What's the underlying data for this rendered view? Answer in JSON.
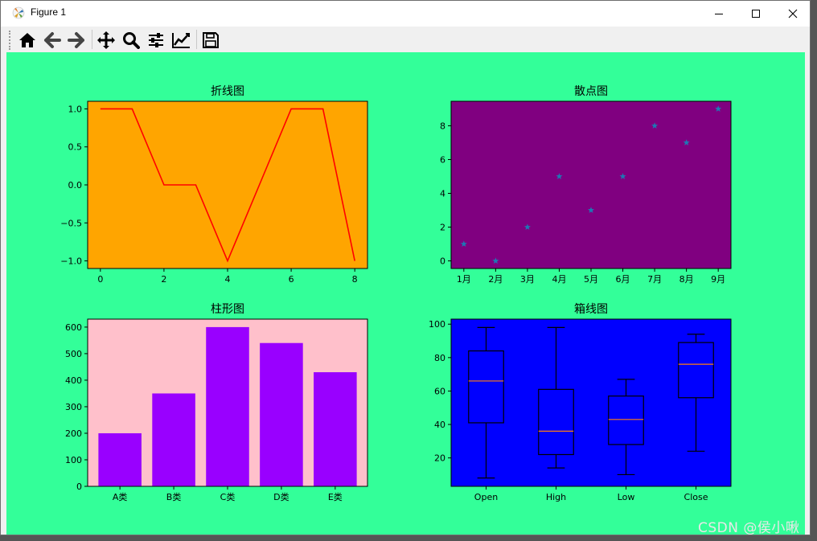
{
  "window": {
    "title": "Figure 1"
  },
  "toolbar": {
    "buttons": [
      "home-icon",
      "back-icon",
      "forward-icon",
      "pan-icon",
      "zoom-icon",
      "configure-subplots-icon",
      "edit-axis-icon",
      "save-icon"
    ]
  },
  "watermark": "CSDN @侯小啾",
  "colors": {
    "canvas": "#33ff99",
    "line_bg": "#ffa500",
    "scatter_bg": "#800080",
    "bar_bg": "#ffc0cb",
    "box_bg": "#0000ff",
    "line": "#ff0000",
    "scatter_marker": "#1f77b4",
    "bar": "#9900ff",
    "median": "#ff7f0e"
  },
  "chart_data": [
    {
      "type": "line",
      "title": "折线图",
      "x": [
        0,
        1,
        2,
        3,
        4,
        5,
        6,
        7,
        8
      ],
      "y": [
        1,
        1,
        0,
        0,
        -1,
        0,
        1,
        1,
        -1
      ],
      "xlim": [
        -0.4,
        8.4
      ],
      "ylim": [
        -1.1,
        1.1
      ],
      "xticks": [
        "0",
        "2",
        "4",
        "6",
        "8"
      ],
      "yticks": [
        "1.0",
        "0.5",
        "0.0",
        "−0.5",
        "−1.0"
      ],
      "grid": false
    },
    {
      "type": "scatter",
      "title": "散点图",
      "categories": [
        "1月",
        "2月",
        "3月",
        "4月",
        "5月",
        "6月",
        "7月",
        "8月",
        "9月"
      ],
      "values": [
        1,
        0,
        2,
        5,
        3,
        5,
        8,
        7,
        9
      ],
      "marker": "star",
      "ylim": [
        -0.45,
        9.45
      ],
      "yticks": [
        "0",
        "2",
        "4",
        "6",
        "8"
      ],
      "grid": false
    },
    {
      "type": "bar",
      "title": "柱形图",
      "categories": [
        "A类",
        "B类",
        "C类",
        "D类",
        "E类"
      ],
      "values": [
        200,
        350,
        600,
        540,
        430
      ],
      "ylim": [
        0,
        630
      ],
      "yticks": [
        "0",
        "100",
        "200",
        "300",
        "400",
        "500",
        "600"
      ],
      "grid": false
    },
    {
      "type": "box",
      "title": "箱线图",
      "categories": [
        "Open",
        "High",
        "Low",
        "Close"
      ],
      "boxes": [
        {
          "min": 8,
          "q1": 41,
          "median": 66,
          "q3": 84,
          "max": 98
        },
        {
          "min": 14,
          "q1": 22,
          "median": 36,
          "q3": 61,
          "max": 98
        },
        {
          "min": 10,
          "q1": 28,
          "median": 43,
          "q3": 57,
          "max": 67
        },
        {
          "min": 24,
          "q1": 56,
          "median": 76,
          "q3": 89,
          "max": 94
        }
      ],
      "ylim": [
        3,
        103
      ],
      "yticks": [
        "20",
        "40",
        "60",
        "80",
        "100"
      ],
      "grid": false
    }
  ]
}
